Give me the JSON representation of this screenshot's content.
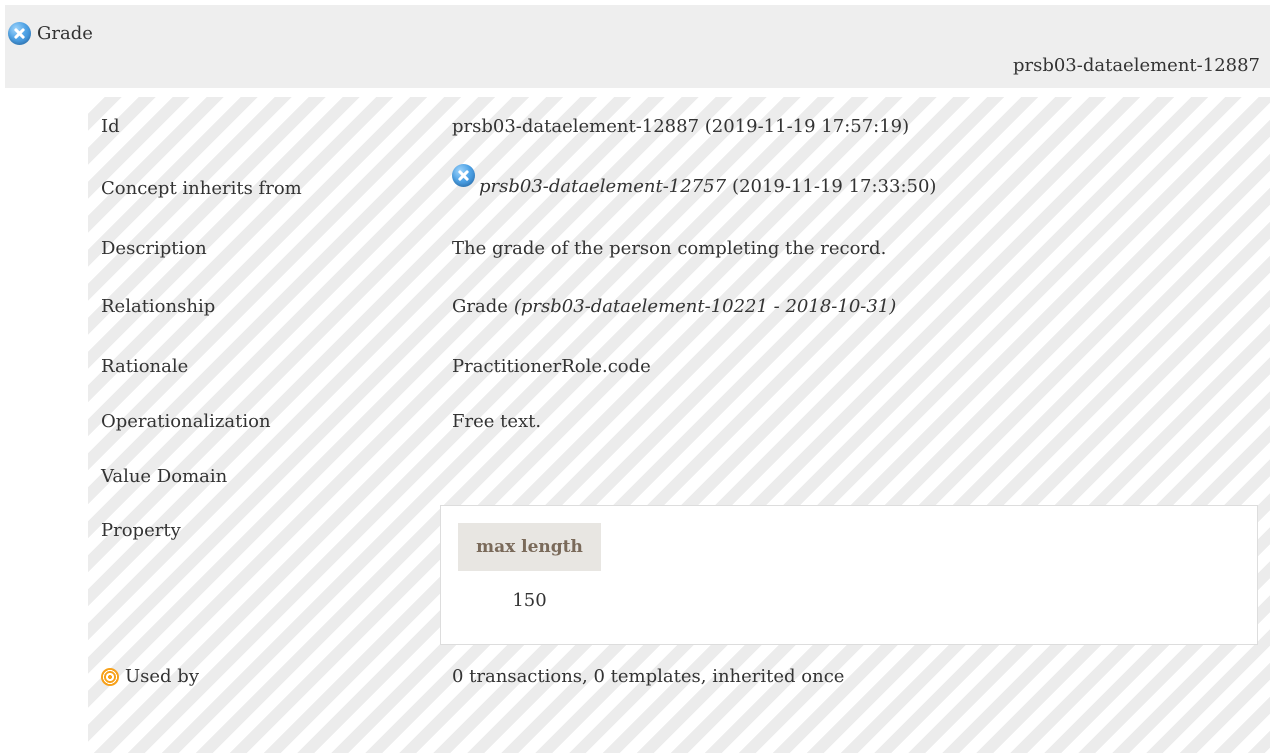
{
  "header": {
    "title": "Grade",
    "element_id": "prsb03-dataelement-12887",
    "icon": "blue-x-circle-icon"
  },
  "rows": {
    "id": {
      "label": "Id",
      "value": "prsb03-dataelement-12887 (2019-11-19 17:57:19)"
    },
    "inherits": {
      "label": "Concept inherits from",
      "link": "prsb03-dataelement-12757",
      "suffix": "(2019-11-19 17:33:50)",
      "icon": "blue-x-circle-icon"
    },
    "description": {
      "label": "Description",
      "value": "The grade of the person completing the record."
    },
    "relationship": {
      "label": "Relationship",
      "name": "Grade",
      "ref": "(prsb03-dataelement-10221 - 2018-10-31)"
    },
    "rationale": {
      "label": "Rationale",
      "value": "PractitionerRole.code"
    },
    "operationalization": {
      "label": "Operationalization",
      "value": "Free text."
    },
    "value_domain": {
      "label": "Value Domain"
    },
    "property": {
      "label": "Property",
      "header": "max length",
      "value": "150"
    },
    "used_by": {
      "label": "Used by",
      "value": "0 transactions, 0 templates, inherited once",
      "icon": "target-icon"
    }
  },
  "colors": {
    "header_bg": "#eeeeee",
    "stripe_light": "#ffffff",
    "stripe_dark": "#ececec",
    "property_header_bg": "#e8e6e2",
    "icon_blue": "#4fa3e6",
    "icon_orange": "#f7a11a"
  }
}
